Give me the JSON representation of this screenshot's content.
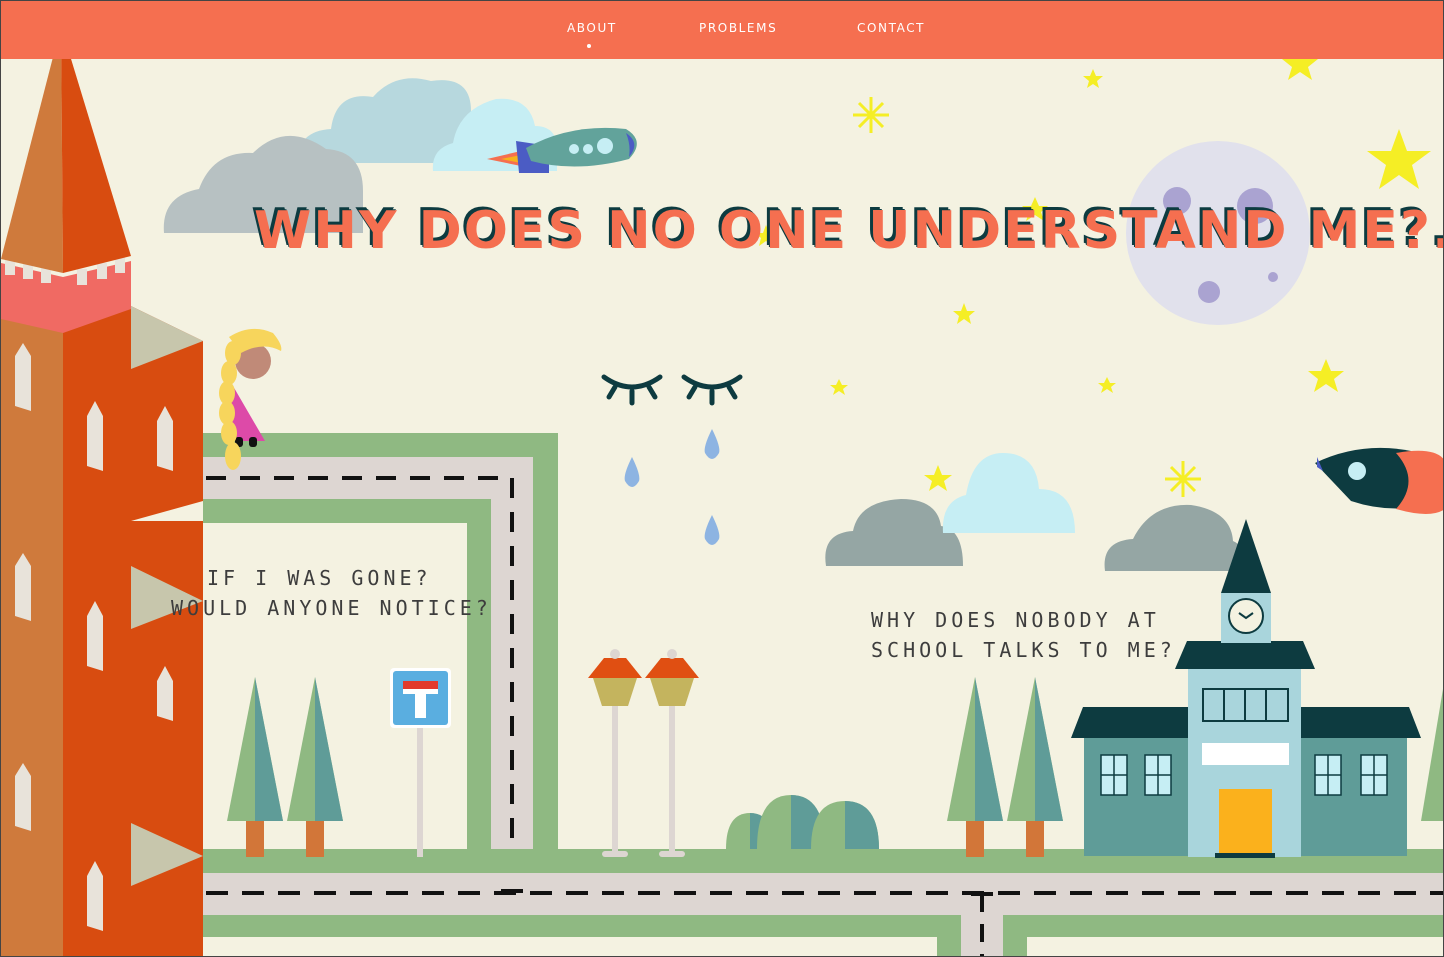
{
  "nav": {
    "items": [
      {
        "label": "ABOUT",
        "active": true
      },
      {
        "label": "PROBLEMS",
        "active": false
      },
      {
        "label": "CONTACT",
        "active": false
      }
    ]
  },
  "hero": {
    "headline": "WHY DOES NO ONE UNDERSTAND ME?..."
  },
  "quotes": {
    "tower_line1": "IF I WAS GONE?",
    "tower_line2": "WOULD ANYONE NOTICE?",
    "school_line1": "WHY DOES NOBODY AT",
    "school_line2": "SCHOOL TALKS TO ME?"
  },
  "colors": {
    "nav_bg": "#f56f50",
    "background": "#f4f2e1",
    "accent_dark": "#0d3b40",
    "road": "#ddd6d2",
    "grass": "#8fb982",
    "tower": "#d84c10"
  },
  "icons": [
    "closed-eyes-icon",
    "teardrop-icon",
    "rocket-icon",
    "star-icon",
    "moon-icon",
    "cloud-icon",
    "dead-end-sign-icon",
    "street-lamp-icon",
    "tree-icon",
    "school-building-icon",
    "castle-tower-icon",
    "girl-figure-icon"
  ]
}
